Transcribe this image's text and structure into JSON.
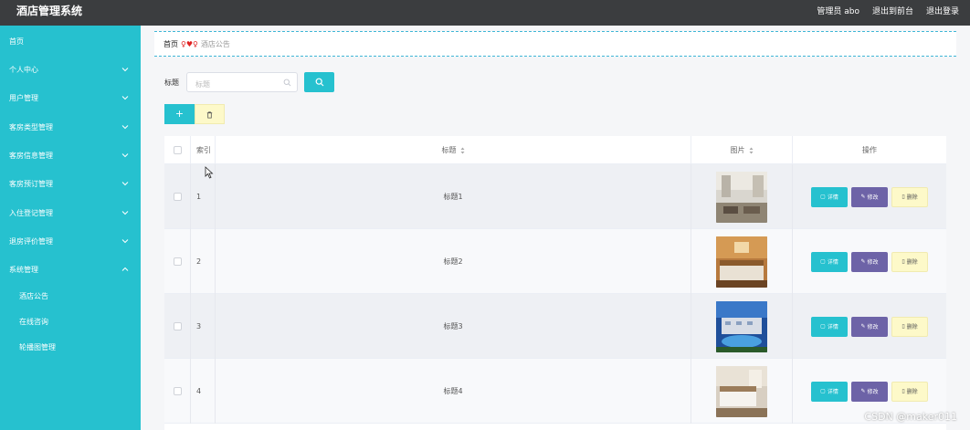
{
  "header": {
    "title": "酒店管理系统",
    "links": [
      "管理员 abo",
      "退出到前台",
      "退出登录"
    ]
  },
  "sidebar": {
    "items": [
      {
        "label": "首页",
        "icon": "none"
      },
      {
        "label": "个人中心",
        "icon": "chevron-down-icon"
      },
      {
        "label": "用户管理",
        "icon": "chevron-down-icon"
      },
      {
        "label": "客房类型管理",
        "icon": "chevron-down-icon"
      },
      {
        "label": "客房信息管理",
        "icon": "chevron-down-icon"
      },
      {
        "label": "客房预订管理",
        "icon": "chevron-down-icon"
      },
      {
        "label": "入住登记管理",
        "icon": "chevron-down-icon"
      },
      {
        "label": "退房评价管理",
        "icon": "chevron-down-icon"
      },
      {
        "label": "系统管理",
        "icon": "chevron-up-icon"
      }
    ],
    "subitems": [
      "酒店公告",
      "在线咨询",
      "轮播图管理"
    ]
  },
  "breadcrumb": {
    "home": "首页",
    "current": "酒店公告"
  },
  "search": {
    "label": "标题",
    "placeholder": "标题"
  },
  "table": {
    "headers": {
      "index": "索引",
      "title": "标题",
      "image": "图片",
      "actions": "操作"
    },
    "rows": [
      {
        "index": "1",
        "title": "标题1"
      },
      {
        "index": "2",
        "title": "标题2"
      },
      {
        "index": "3",
        "title": "标题3"
      },
      {
        "index": "4",
        "title": "标题4"
      }
    ],
    "row_buttons": {
      "detail": "详情",
      "edit": "修改",
      "delete": "删除"
    }
  },
  "colors": {
    "accent": "#26c1cf",
    "topbar": "#3b3d3f",
    "edit": "#6d63a7",
    "delete_bg": "#fdf9c9"
  },
  "watermark": "CSDN @maker011"
}
